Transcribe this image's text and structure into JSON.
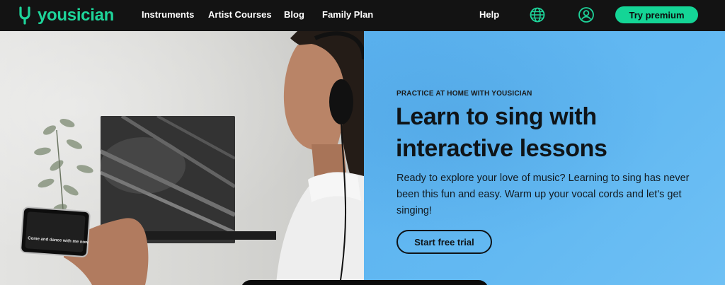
{
  "brand": {
    "name": "yousician",
    "color": "#1ed49a"
  },
  "nav": {
    "links": [
      "Instruments",
      "Artist Courses",
      "Blog",
      "Family Plan"
    ],
    "help_label": "Help",
    "globe_icon": "globe-icon",
    "account_icon": "user-circle-icon",
    "premium_label": "Try premium"
  },
  "hero": {
    "eyebrow": "PRACTICE AT HOME WITH YOUSICIAN",
    "headline": "Learn to sing with interactive lessons",
    "body": "Ready to explore your love of music? Learning to sing has never been this fun and easy. Warm up your vocal cords and let's get singing!",
    "cta_label": "Start free trial",
    "phone_caption": "Come and dance with me now",
    "accent_color": "#14d596",
    "panel_color": "#5bb2ef"
  }
}
